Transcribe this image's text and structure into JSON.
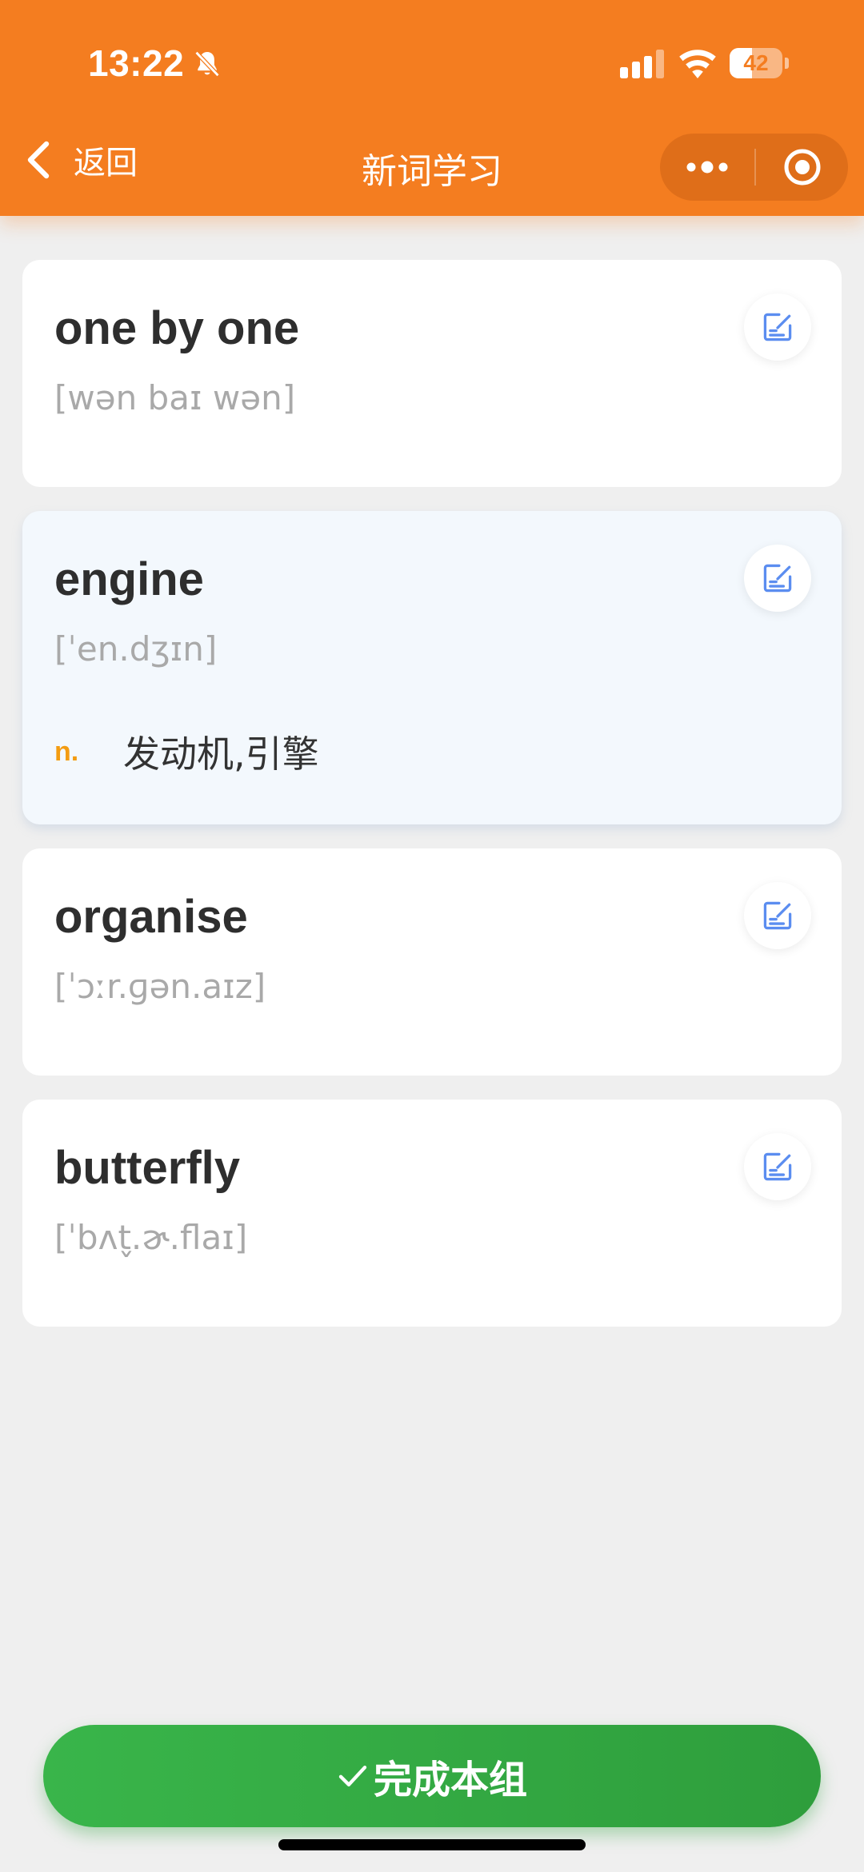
{
  "status_bar": {
    "time": "13:22",
    "battery": "42",
    "battery_level": 0.42,
    "icons": [
      "bell-off-icon",
      "signal-icon",
      "wifi-icon",
      "battery-icon"
    ]
  },
  "nav": {
    "back_label": "返回",
    "title": "新词学习",
    "more_icon": "more-dots-icon",
    "close_icon": "target-circle-icon"
  },
  "colors": {
    "header": "#f47d20",
    "active_card": "#f3f8fd",
    "pos": "#f39c12",
    "edit_icon": "#5b8df0",
    "done_button": "#39b54a"
  },
  "words": [
    {
      "word": "one by one",
      "phonetic": "[wən baɪ wən]",
      "pos": "",
      "definition": ""
    },
    {
      "word": "engine",
      "phonetic": "[ˈen.dʒɪn]",
      "pos": "n.",
      "definition": "发动机,引擎"
    },
    {
      "word": "organise",
      "phonetic": "[ˈɔːr.ɡən.aɪz]",
      "pos": "",
      "definition": ""
    },
    {
      "word": "butterfly",
      "phonetic": "[ˈbʌt̬.ɚ.flaɪ]",
      "pos": "",
      "definition": ""
    }
  ],
  "done_button": {
    "label": "完成本组",
    "icon": "check-icon"
  }
}
